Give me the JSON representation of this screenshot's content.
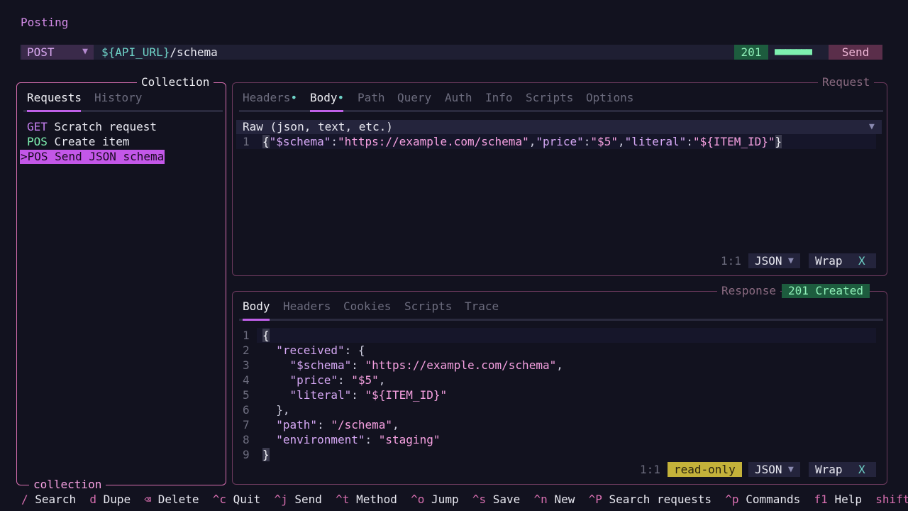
{
  "app": {
    "title": "Posting"
  },
  "url_bar": {
    "method": "POST",
    "url_var": "${API_URL}",
    "url_path": "/schema",
    "status": "201",
    "progress": "■■■■■■■",
    "send_label": "Send"
  },
  "collection": {
    "title": "Collection",
    "footer": "collection",
    "tabs": [
      {
        "label": "Requests"
      },
      {
        "label": "History"
      }
    ],
    "items": [
      {
        "method": "GET",
        "name": "Scratch request"
      },
      {
        "method": "POS",
        "name": "Create item"
      },
      {
        "method": ">POS",
        "name": "Send JSON schema"
      }
    ]
  },
  "request": {
    "title": "Request",
    "tabs": [
      {
        "label": "Headers",
        "dot": "•"
      },
      {
        "label": "Body",
        "dot": "•"
      },
      {
        "label": "Path"
      },
      {
        "label": "Query"
      },
      {
        "label": "Auth"
      },
      {
        "label": "Info"
      },
      {
        "label": "Scripts"
      },
      {
        "label": "Options"
      }
    ],
    "body_type": "Raw (json, text, etc.)",
    "line_no": "1",
    "body_tokens": {
      "open": "{",
      "k1": "\"$schema\"",
      "v1": "\"https://example.com/schema\"",
      "k2": "\"price\"",
      "v2": "\"$5\"",
      "k3": "\"literal\"",
      "v3": "\"${ITEM_ID}\"",
      "close": "}"
    },
    "cursor_pos": "1:1",
    "language": "JSON",
    "wrap_label": "Wrap",
    "wrap_value": "X"
  },
  "response": {
    "title": "Response",
    "status_chip": "201 Created",
    "tabs": [
      {
        "label": "Body"
      },
      {
        "label": "Headers"
      },
      {
        "label": "Cookies"
      },
      {
        "label": "Scripts"
      },
      {
        "label": "Trace"
      }
    ],
    "lines": [
      {
        "n": "1",
        "k": "",
        "v": "{",
        "pre": "",
        "post": ""
      },
      {
        "n": "2",
        "k": "\"received\"",
        "v": "",
        "pre": "  ",
        "post": ": {"
      },
      {
        "n": "3",
        "k": "\"$schema\"",
        "v": "\"https://example.com/schema\"",
        "pre": "    ",
        "post": ","
      },
      {
        "n": "4",
        "k": "\"price\"",
        "v": "\"$5\"",
        "pre": "    ",
        "post": ","
      },
      {
        "n": "5",
        "k": "\"literal\"",
        "v": "\"${ITEM_ID}\"",
        "pre": "    ",
        "post": ""
      },
      {
        "n": "6",
        "k": "",
        "v": "",
        "pre": "  ",
        "post": "},"
      },
      {
        "n": "7",
        "k": "\"path\"",
        "v": "\"/schema\"",
        "pre": "  ",
        "post": ","
      },
      {
        "n": "8",
        "k": "\"environment\"",
        "v": "\"staging\"",
        "pre": "  ",
        "post": ""
      },
      {
        "n": "9",
        "k": "",
        "v": "}",
        "pre": "",
        "post": ""
      }
    ],
    "cursor_pos": "1:1",
    "readonly_label": "read-only",
    "language": "JSON",
    "wrap_label": "Wrap",
    "wrap_value": "X"
  },
  "shortcuts": [
    {
      "key": "/",
      "label": "Search"
    },
    {
      "key": "d",
      "label": "Dupe"
    },
    {
      "key": "⌫",
      "label": "Delete"
    },
    {
      "key": "^c",
      "label": "Quit"
    },
    {
      "key": "^j",
      "label": "Send"
    },
    {
      "key": "^t",
      "label": "Method"
    },
    {
      "key": "^o",
      "label": "Jump"
    },
    {
      "key": "^s",
      "label": "Save"
    },
    {
      "key": "^n",
      "label": "New"
    },
    {
      "key": "^P",
      "label": "Search requests"
    },
    {
      "key": "^p",
      "label": "Commands"
    },
    {
      "key": "f1",
      "label": "Help"
    },
    {
      "key": "shift+",
      "label": ""
    }
  ]
}
